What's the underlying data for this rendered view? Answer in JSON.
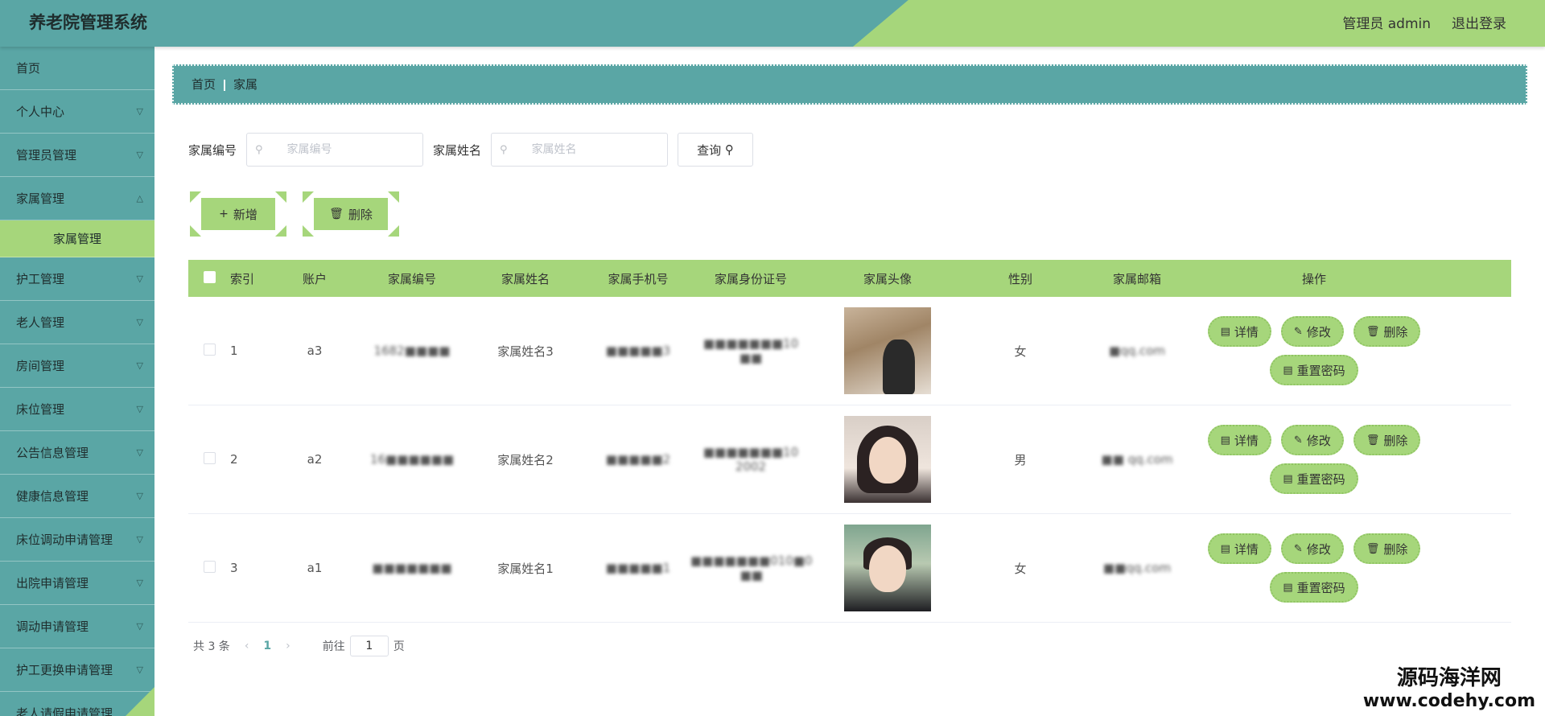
{
  "header": {
    "title": "养老院管理系统",
    "user": "管理员 admin",
    "logout": "退出登录"
  },
  "sidebar": {
    "items": [
      {
        "label": "首页"
      },
      {
        "label": "个人中心"
      },
      {
        "label": "管理员管理"
      },
      {
        "label": "家属管理"
      },
      {
        "label": "家属管理"
      },
      {
        "label": "护工管理"
      },
      {
        "label": "老人管理"
      },
      {
        "label": "房间管理"
      },
      {
        "label": "床位管理"
      },
      {
        "label": "公告信息管理"
      },
      {
        "label": "健康信息管理"
      },
      {
        "label": "床位调动申请管理"
      },
      {
        "label": "出院申请管理"
      },
      {
        "label": "调动申请管理"
      },
      {
        "label": "护工更换申请管理"
      },
      {
        "label": "老人请假申请管理"
      }
    ]
  },
  "breadcrumb": {
    "home": "首页",
    "current": "家属"
  },
  "search": {
    "field1_label": "家属编号",
    "field1_placeholder": "家属编号",
    "field2_label": "家属姓名",
    "field2_placeholder": "家属姓名",
    "query": "查询"
  },
  "actions": {
    "add": "新增",
    "delete": "删除"
  },
  "table": {
    "headers": [
      "索引",
      "账户",
      "家属编号",
      "家属姓名",
      "家属手机号",
      "家属身份证号",
      "家属头像",
      "性别",
      "家属邮箱",
      "操作"
    ],
    "rows": [
      {
        "index": "1",
        "account": "a3",
        "no": "1682■■■■",
        "name": "家属姓名3",
        "phone": "■■■■■3",
        "idcard": "■■■■■■■10 ■■",
        "sex": "女",
        "email": "■qq.com"
      },
      {
        "index": "2",
        "account": "a2",
        "no": "16■■■■■■",
        "name": "家属姓名2",
        "phone": "■■■■■2",
        "idcard": "■■■■■■■10 2002",
        "sex": "男",
        "email": "■■ qq.com"
      },
      {
        "index": "3",
        "account": "a1",
        "no": "■■■■■■■",
        "name": "家属姓名1",
        "phone": "■■■■■1",
        "idcard": "■■■■■■■010■0 ■■",
        "sex": "女",
        "email": "■■qq.com"
      }
    ],
    "ops": {
      "detail": "详情",
      "edit": "修改",
      "delete": "删除",
      "reset": "重置密码"
    }
  },
  "pager": {
    "total": "共 3 条",
    "current": "1",
    "goto": "前往",
    "page_value": "1",
    "page_unit": "页"
  },
  "watermark": {
    "line1": "源码海洋网",
    "line2": "www.codehy.com"
  }
}
